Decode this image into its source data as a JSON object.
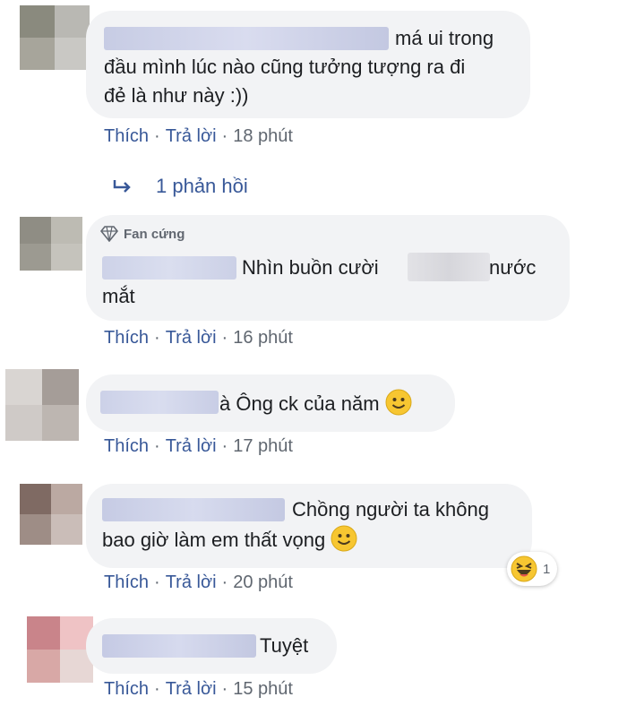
{
  "comments": [
    {
      "text_line1": "má ui trong",
      "text_line2": "đầu mình lúc nào cũng tưởng tượng ra đi",
      "text_line3": "đẻ là như này :))",
      "like": "Thích",
      "reply": "Trả lời",
      "time": "18 phút"
    },
    {
      "badge": "Fan cứng",
      "text_part1": "Nhìn buồn cười",
      "text_part2": "nước",
      "text_line2": "mắt",
      "like": "Thích",
      "reply": "Trả lời",
      "time": "16 phút"
    },
    {
      "text": "à Ông ck của năm",
      "like": "Thích",
      "reply": "Trả lời",
      "time": "17 phút"
    },
    {
      "text_line1": "Chồng người ta không",
      "text_line2": "bao giờ làm em thất vọng",
      "like": "Thích",
      "reply": "Trả lời",
      "time": "20 phút",
      "reaction_count": "1"
    },
    {
      "text": "Tuyệt",
      "like": "Thích",
      "reply": "Trả lời",
      "time": "15 phút"
    }
  ],
  "replies_link": "1 phản hồi",
  "colors": {
    "bubble": "#f2f3f5",
    "link": "#385898",
    "meta": "#606770"
  },
  "icons": {
    "reply_arrow": "reply-arrow-icon",
    "badge": "diamond-icon",
    "smile": "smile-emoji-icon",
    "haha": "haha-reaction-icon"
  }
}
